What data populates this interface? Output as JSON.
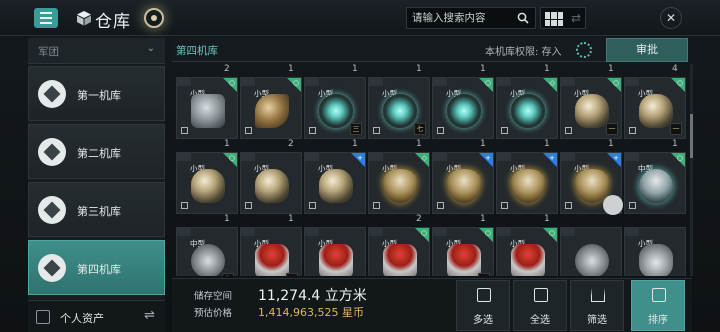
{
  "header": {
    "title": "仓库",
    "search_placeholder": "请输入搜索内容",
    "accent": "#3f8f8a"
  },
  "sidebar": {
    "filter_label": "军团",
    "items": [
      {
        "label": "第一机库"
      },
      {
        "label": "第二机库"
      },
      {
        "label": "第三机库"
      },
      {
        "label": "第四机库"
      }
    ],
    "active_index": 3,
    "footer_label": "个人资产"
  },
  "main": {
    "hangar_name": "第四机库",
    "permission_text": "本机库权限:  存入",
    "approve_label": "审批"
  },
  "items": [
    {
      "count": "2",
      "size": "小型",
      "tag": "green",
      "badge": "○",
      "art": "mech",
      "tier": ""
    },
    {
      "count": "1",
      "size": "小型",
      "tag": "green",
      "badge": "○",
      "art": "dish",
      "tier": ""
    },
    {
      "count": "1",
      "size": "小型",
      "tag": "none",
      "badge": "",
      "art": "orb",
      "tier": "三"
    },
    {
      "count": "1",
      "size": "小型",
      "tag": "none",
      "badge": "",
      "art": "orb",
      "tier": "七"
    },
    {
      "count": "1",
      "size": "小型",
      "tag": "green",
      "badge": "○",
      "art": "orb",
      "tier": ""
    },
    {
      "count": "1",
      "size": "小型",
      "tag": "green",
      "badge": "◇",
      "art": "orb",
      "tier": ""
    },
    {
      "count": "1",
      "size": "小型",
      "tag": "green",
      "badge": "○",
      "art": "helmet",
      "tier": "一"
    },
    {
      "count": "4",
      "size": "小型",
      "tag": "green",
      "badge": "○",
      "art": "helmet",
      "tier": "一"
    },
    {
      "count": "1",
      "size": "小型",
      "tag": "green",
      "badge": "○",
      "art": "helmet",
      "tier": ""
    },
    {
      "count": "2",
      "size": "小型",
      "tag": "none",
      "badge": "",
      "art": "helmet",
      "tier": ""
    },
    {
      "count": "1",
      "size": "小型",
      "tag": "blue",
      "badge": "+",
      "art": "helmet",
      "tier": ""
    },
    {
      "count": "1",
      "size": "小型",
      "tag": "green",
      "badge": "◇",
      "art": "shield",
      "tier": ""
    },
    {
      "count": "1",
      "size": "小型",
      "tag": "blue",
      "badge": "+",
      "art": "shield",
      "tier": ""
    },
    {
      "count": "1",
      "size": "小型",
      "tag": "blue",
      "badge": "+",
      "art": "shield",
      "tier": ""
    },
    {
      "count": "1",
      "size": "小型",
      "tag": "blue",
      "badge": "+",
      "art": "shield",
      "tier": ""
    },
    {
      "count": "1",
      "size": "中型",
      "tag": "green",
      "badge": "○",
      "art": "teal",
      "tier": ""
    },
    {
      "count": "1",
      "size": "中型",
      "tag": "none",
      "badge": "",
      "art": "module",
      "tier": "七"
    },
    {
      "count": "1",
      "size": "小型",
      "tag": "none",
      "badge": "",
      "art": "canister",
      "tier": "五"
    },
    {
      "count": "",
      "size": "小型",
      "tag": "none",
      "badge": "",
      "art": "canister",
      "tier": ""
    },
    {
      "count": "2",
      "size": "小型",
      "tag": "green",
      "badge": "○",
      "art": "canister",
      "tier": ""
    },
    {
      "count": "1",
      "size": "小型",
      "tag": "green",
      "badge": "○",
      "art": "canister",
      "tier": "五"
    },
    {
      "count": "1",
      "size": "小型",
      "tag": "green",
      "badge": "○",
      "art": "canister",
      "tier": ""
    },
    {
      "count": "",
      "size": "",
      "tag": "none",
      "badge": "",
      "art": "module",
      "tier": ""
    },
    {
      "count": "",
      "size": "小型",
      "tag": "none",
      "badge": "",
      "art": "drone",
      "tier": ""
    }
  ],
  "bottom": {
    "storage_label": "储存空间",
    "storage_value": "11,274.4 立方米",
    "price_label": "预估价格",
    "price_value": "1,414,963,525 星币",
    "actions": [
      {
        "label": "多选",
        "icon": "check-square-icon"
      },
      {
        "label": "全选",
        "icon": "check-all-icon"
      },
      {
        "label": "筛选",
        "icon": "filter-icon"
      },
      {
        "label": "排序",
        "icon": "sort-icon"
      }
    ]
  }
}
